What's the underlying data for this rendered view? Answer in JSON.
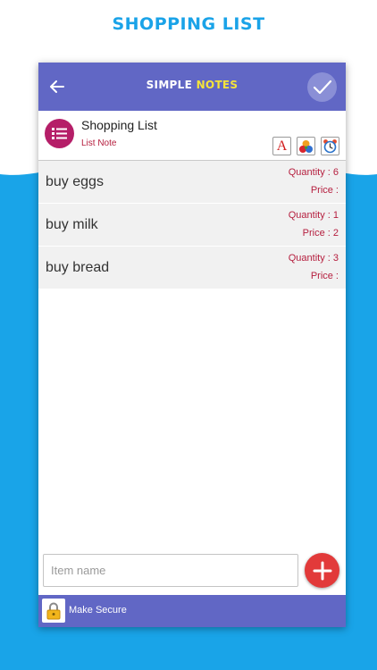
{
  "promo": {
    "title": "SHOPPING LIST"
  },
  "app": {
    "title_part1": "SIMPLE",
    "title_part2": "NOTES"
  },
  "icons": {
    "back": "arrow-left-icon",
    "done": "checkmark-icon",
    "note_type": "list-icon",
    "font": "font-style-icon",
    "color": "color-palette-icon",
    "alarm": "alarm-clock-icon",
    "add": "plus-icon",
    "lock": "padlock-icon"
  },
  "note": {
    "title": "Shopping List",
    "type": "List Note",
    "font_label": "A"
  },
  "items": [
    {
      "name": "buy eggs",
      "quantity": "Quantity : 6",
      "price": "Price :"
    },
    {
      "name": "buy milk",
      "quantity": "Quantity : 1",
      "price": "Price : 2"
    },
    {
      "name": "buy bread",
      "quantity": "Quantity : 3",
      "price": "Price :"
    }
  ],
  "input": {
    "placeholder": "Item name",
    "value": ""
  },
  "footer": {
    "secure_label": "Make Secure"
  },
  "colors": {
    "accent": "#6167c5",
    "promo_blue": "#1aa3e8",
    "note_icon": "#b51e68",
    "label_red": "#b51e3e",
    "add_button": "#e23a3a",
    "title_yellow": "#f5e43a"
  }
}
